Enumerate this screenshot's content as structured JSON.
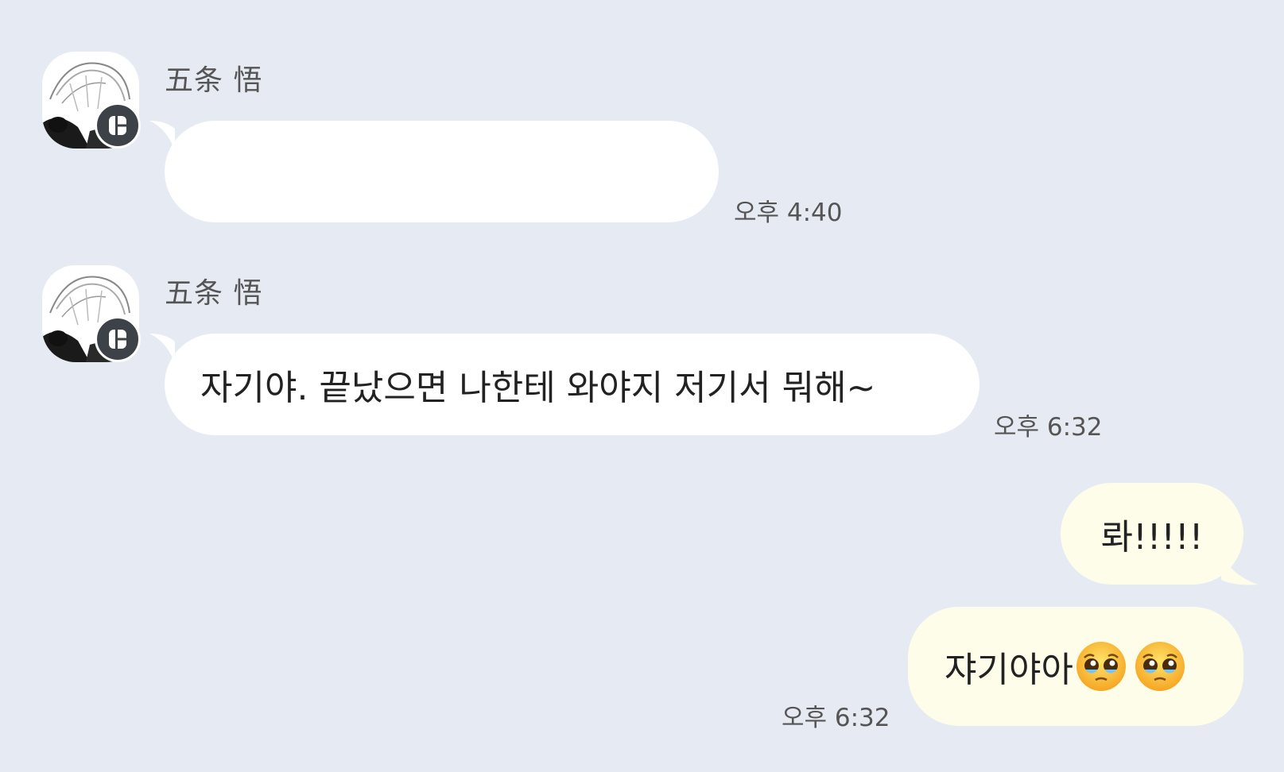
{
  "chat": {
    "messages": [
      {
        "direction": "incoming",
        "sender": "五条 悟",
        "text": "",
        "time": "오후 4:40"
      },
      {
        "direction": "incoming",
        "sender": "五条 悟",
        "text": "자기야. 끝났으면 나한테 와야지 저기서 뭐해~",
        "time": "오후 6:32"
      },
      {
        "direction": "outgoing",
        "text": "롸!!!!!",
        "time": ""
      },
      {
        "direction": "outgoing",
        "text": "쟈기야아",
        "emojis": [
          "pleading-face-emoji",
          "pleading-face-emoji"
        ],
        "time": "오후 6:32"
      }
    ]
  },
  "colors": {
    "background": "#e6ebf3",
    "incoming_bubble": "#ffffff",
    "outgoing_bubble": "#fefde9",
    "badge": "#3d4248"
  },
  "icons": {
    "avatar": "profile-avatar",
    "badge": "app-badge-icon"
  }
}
